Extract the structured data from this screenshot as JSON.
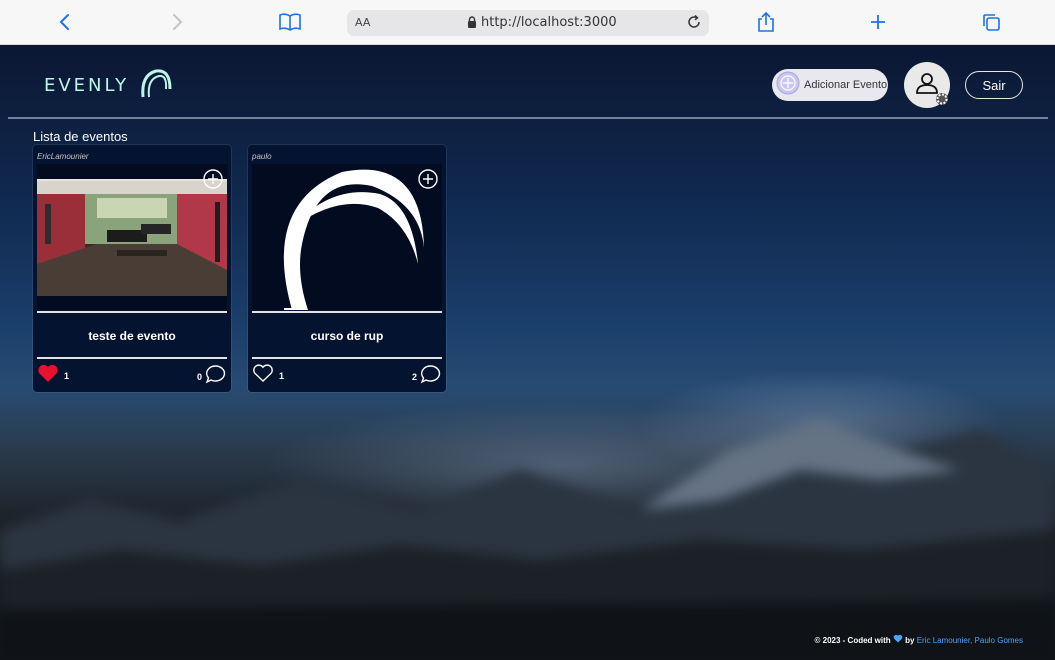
{
  "browser": {
    "text_size_label": "AA",
    "url": "http://localhost:3000"
  },
  "header": {
    "logo_text": "EVENLY",
    "add_event_label": "Adicionar Evento",
    "logout_label": "Sair"
  },
  "main": {
    "section_title": "Lista de eventos",
    "events": [
      {
        "author": "EricLamounier",
        "title": "teste de evento",
        "likes": "1",
        "liked": true,
        "comments": "0",
        "image": "restaurant-photo"
      },
      {
        "author": "paulo",
        "title": "curso de rup",
        "likes": "1",
        "liked": false,
        "comments": "2",
        "image": "evenly-logo"
      }
    ]
  },
  "footer": {
    "prefix": "© 2023 - Coded with",
    "by": "by",
    "author1": "Eric Lamounier,",
    "author2": "Paulo Gomes"
  },
  "colors": {
    "accent": "#bff5e6",
    "like": "#e8112d",
    "link": "#4ea3ff",
    "card_bg": "#041430"
  },
  "icons": [
    "back-icon",
    "forward-icon",
    "bookmarks-icon",
    "lock-icon",
    "reload-icon",
    "share-icon",
    "new-tab-icon",
    "tabs-icon",
    "plus-circle-icon",
    "user-icon",
    "gear-icon",
    "heart-icon",
    "comment-icon"
  ]
}
